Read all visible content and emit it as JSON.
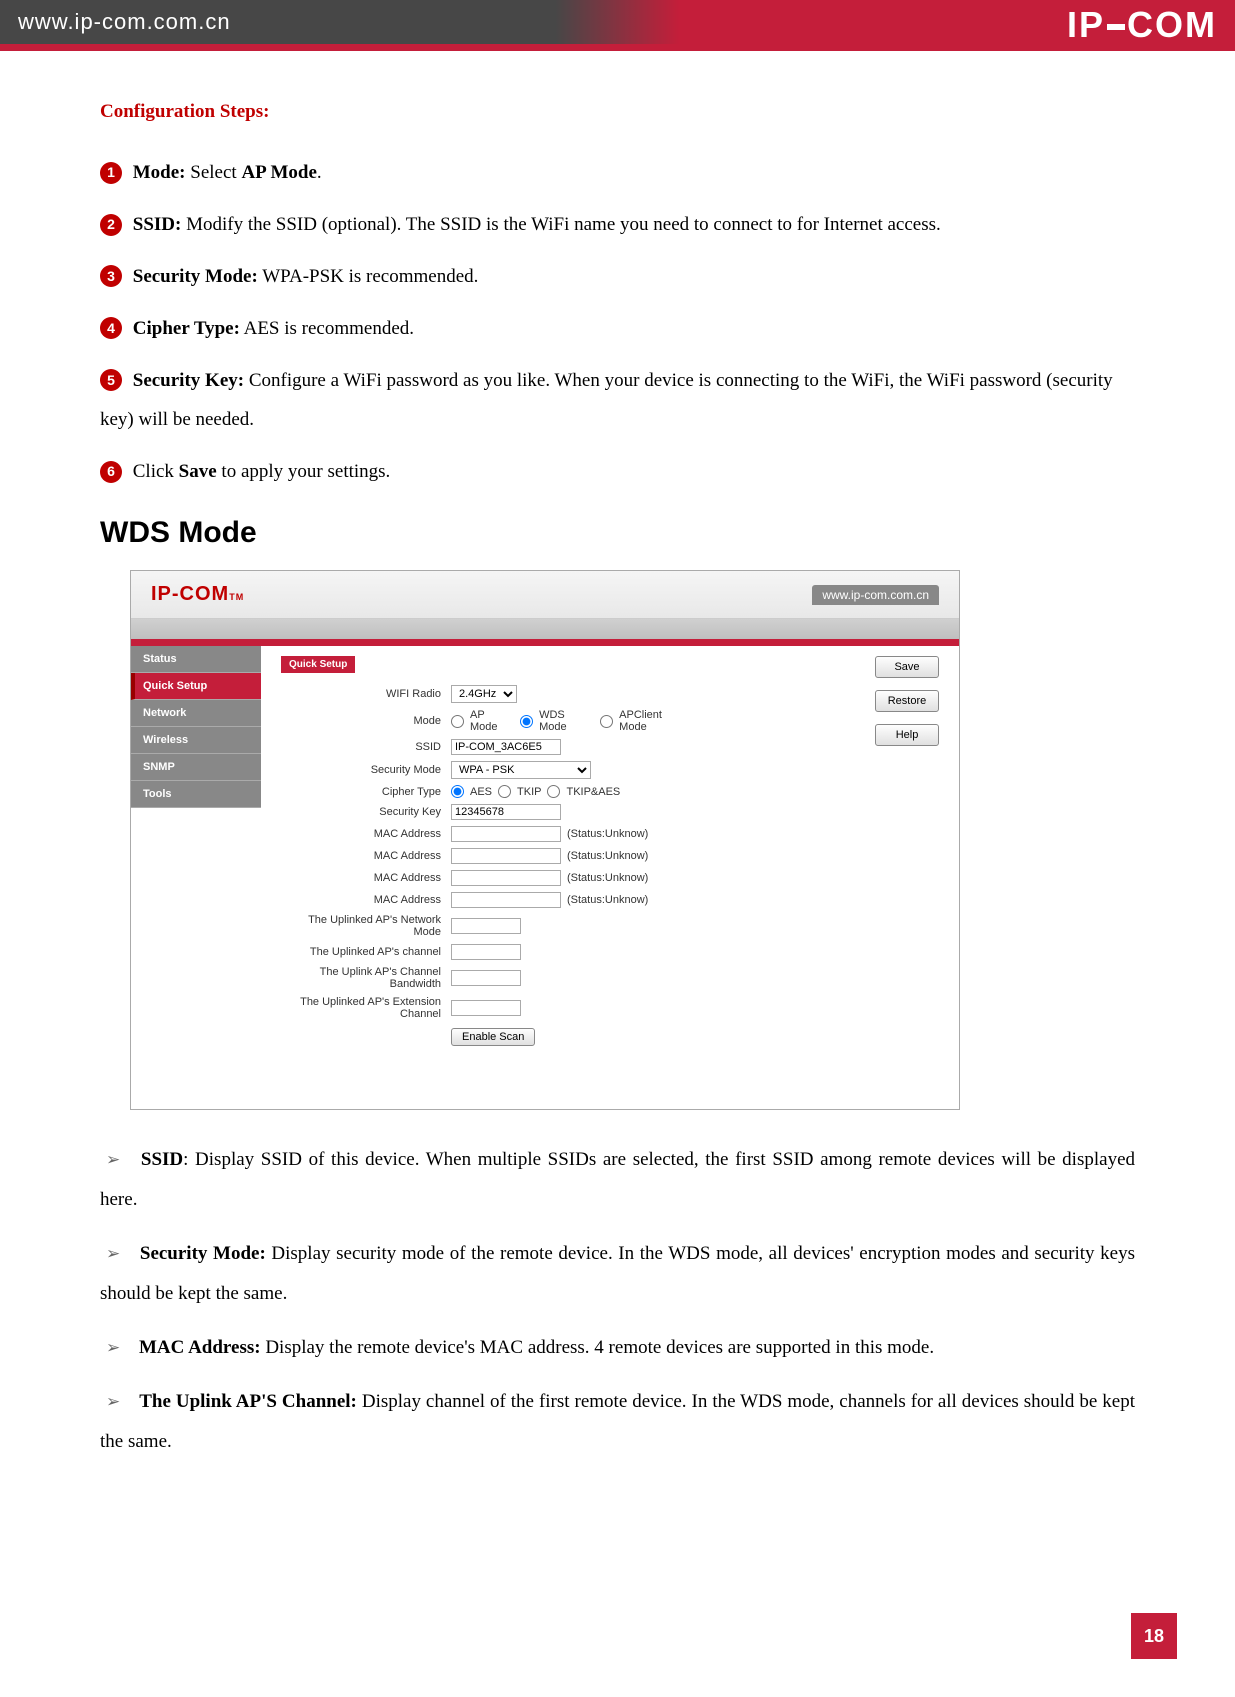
{
  "header": {
    "url": "www.ip-com.com.cn",
    "logo": "IP-COM"
  },
  "config": {
    "title": "Configuration Steps:",
    "steps": [
      {
        "num": "1",
        "label": "Mode:",
        "text": " Select ",
        "bold": "AP Mode",
        "suffix": "."
      },
      {
        "num": "2",
        "label": "SSID:",
        "text": " Modify the SSID (optional). The SSID is the WiFi name you need to connect to for Internet access."
      },
      {
        "num": "3",
        "label": "Security Mode:",
        "text": " WPA-PSK is recommended."
      },
      {
        "num": "4",
        "label": "Cipher Type:",
        "text": " AES is recommended."
      },
      {
        "num": "5",
        "label": "Security Key:",
        "text": " Configure a WiFi password as you like. When your device is connecting to the WiFi, the WiFi password (security key) will be needed."
      },
      {
        "num": "6",
        "label": "",
        "text": "Click ",
        "bold": "Save",
        "suffix": " to apply your settings."
      }
    ]
  },
  "section_title": "WDS Mode",
  "screenshot": {
    "brand": "IP-COM",
    "brand_tm": "TM",
    "url": "www.ip-com.com.cn",
    "sidebar": [
      "Status",
      "Quick Setup",
      "Network",
      "Wireless",
      "SNMP",
      "Tools"
    ],
    "active_tab": "Quick Setup",
    "buttons": {
      "save": "Save",
      "restore": "Restore",
      "help": "Help"
    },
    "form": {
      "wifi_radio_label": "WIFI Radio",
      "wifi_radio_value": "2.4GHz",
      "mode_label": "Mode",
      "mode_ap": "AP Mode",
      "mode_wds": "WDS Mode",
      "mode_apclient": "APClient Mode",
      "ssid_label": "SSID",
      "ssid_value": "IP-COM_3AC6E5",
      "sec_label": "Security Mode",
      "sec_value": "WPA - PSK",
      "cipher_label": "Cipher Type",
      "cipher_aes": "AES",
      "cipher_tkip": "TKIP",
      "cipher_both": "TKIP&AES",
      "key_label": "Security Key",
      "key_value": "12345678",
      "mac_label": "MAC Address",
      "mac_status": "(Status:Unknow)",
      "uplink_net": "The Uplinked AP's Network Mode",
      "uplink_ch": "The Uplinked AP's channel",
      "uplink_bw": "The Uplink AP's Channel Bandwidth",
      "uplink_ext": "The Uplinked AP's Extension Channel",
      "enable_scan": "Enable Scan"
    }
  },
  "bullets": [
    {
      "label": "SSID",
      "text": ": Display SSID of this device. When multiple SSIDs are selected, the first SSID among remote devices will be displayed here."
    },
    {
      "label": "Security Mode:",
      "text": " Display security mode of the remote device. In the WDS mode, all devices' encryption modes and security keys should be kept the same."
    },
    {
      "label": "MAC Address:",
      "text": " Display the remote device's MAC address. 4 remote devices are supported in this mode."
    },
    {
      "label": "The Uplink AP'S Channel:",
      "text": " Display channel of the first remote device. In the WDS mode, channels for all devices should be kept the same."
    }
  ],
  "page_number": "18"
}
